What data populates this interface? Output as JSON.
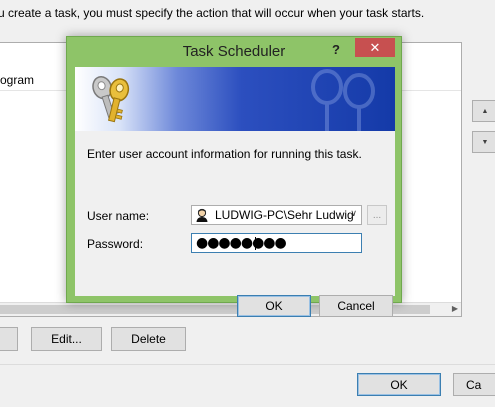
{
  "background": {
    "description": "u create a task, you must specify the action that will occur when your task starts.",
    "list_column_text": "ogram",
    "buttons": {
      "edit": "Edit...",
      "delete": "Delete",
      "ok": "OK",
      "cancel_partial": "Ca"
    },
    "side_buttons": {
      "up": "▲",
      "down": "▼"
    }
  },
  "dialog": {
    "title": "Task Scheduler",
    "help_glyph": "?",
    "close_glyph": "✕",
    "prompt": "Enter user account information for running this task.",
    "user_name_label": "User name:",
    "user_name_value": "LUDWIG-PC\\Sehr Ludwig",
    "user_chevron": "∨",
    "browse_label": "...",
    "password_label": "Password:",
    "password_value": "●●●●●●●●",
    "ok_label": "OK",
    "cancel_label": "Cancel",
    "icons": {
      "banner": "keys-icon",
      "user": "user-account-icon"
    },
    "colors": {
      "frame": "#8ec468",
      "close": "#c75050",
      "banner_dark": "#143aa8"
    }
  }
}
